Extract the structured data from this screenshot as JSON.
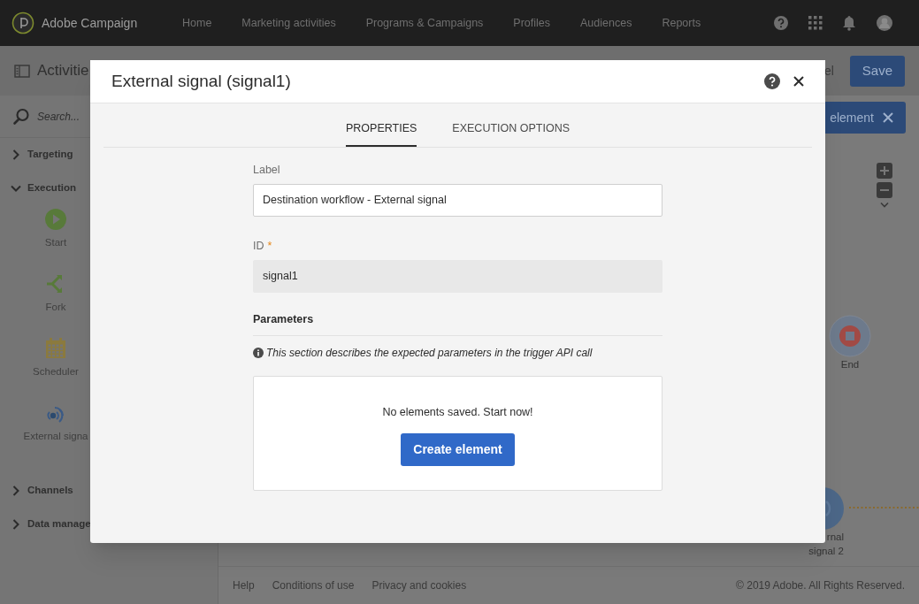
{
  "header": {
    "brand": "Adobe Campaign",
    "nav": [
      {
        "label": "Home",
        "selected": false
      },
      {
        "label": "Marketing activities",
        "selected": false
      },
      {
        "label": "Programs & Campaigns",
        "selected": false
      },
      {
        "label": "Profiles",
        "selected": false
      },
      {
        "label": "Audiences",
        "selected": false
      },
      {
        "label": "Reports",
        "selected": false
      }
    ]
  },
  "toolbar": {
    "title": "Activitie",
    "cancel": "el",
    "save": "Save"
  },
  "sidebar": {
    "search_placeholder": "Search...",
    "categories": [
      {
        "label": "Targeting",
        "expanded": false
      },
      {
        "label": "Execution",
        "expanded": true,
        "items": [
          {
            "kind": "start",
            "label": "Start"
          },
          {
            "kind": "fork",
            "label": "Fork"
          },
          {
            "kind": "scheduler",
            "label": "Scheduler"
          },
          {
            "kind": "signal",
            "label": "External signa"
          }
        ]
      },
      {
        "label": "Channels",
        "expanded": false
      },
      {
        "label": "Data manage",
        "expanded": false
      }
    ]
  },
  "canvas": {
    "add_button": "element",
    "nodes": [
      {
        "kind": "end",
        "label_lines": [
          "End"
        ]
      },
      {
        "kind": "signal",
        "label_lines": [
          "rnal",
          "signal 2"
        ]
      }
    ]
  },
  "footer": {
    "links": [
      "Help",
      "Conditions of use",
      "Privacy and cookies"
    ],
    "copyright": "© 2019 Adobe. All Rights Reserved."
  },
  "dialog": {
    "title": "External signal (signal1)",
    "tabs": [
      {
        "label": "PROPERTIES",
        "selected": true
      },
      {
        "label": "EXECUTION OPTIONS",
        "selected": false
      }
    ],
    "fields": [
      {
        "label": "Label",
        "value": "Destination workflow - External signal",
        "readonly": false
      },
      {
        "label": "ID",
        "required_mark": "*",
        "value": "signal1",
        "readonly": true
      }
    ],
    "section_title": "Parameters",
    "info": "This section describes the expected parameters in the trigger API call",
    "empty_text": "No elements saved. Start now!",
    "create_button": "Create element"
  }
}
